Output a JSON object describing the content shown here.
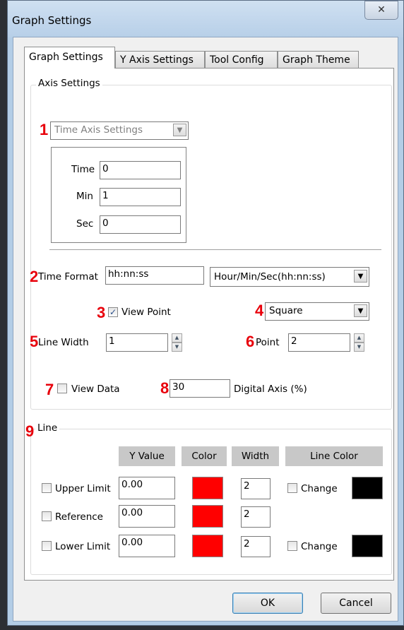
{
  "window": {
    "title": "Graph Settings",
    "close_glyph": "✕"
  },
  "tabs": [
    {
      "label": "Graph Settings"
    },
    {
      "label": "Y Axis Settings"
    },
    {
      "label": "Tool Config"
    },
    {
      "label": "Graph Theme"
    }
  ],
  "axis": {
    "legend": "Axis Settings",
    "time_axis_select": "Time Axis Settings",
    "fields": [
      {
        "label": "Time",
        "value": "0"
      },
      {
        "label": "Min",
        "value": "1"
      },
      {
        "label": "Sec",
        "value": "0"
      }
    ],
    "time_format_label": "Time Format",
    "time_format_value": "hh:nn:ss",
    "time_format_select": "Hour/Min/Sec(hh:nn:ss)",
    "view_point_label": "View Point",
    "view_point_checked": true,
    "point_shape": "Square",
    "line_width_label": "Line Width",
    "line_width_value": "1",
    "point_label": "Point",
    "point_value": "2",
    "view_data_label": "View Data",
    "view_data_checked": false,
    "digital_axis_value": "30",
    "digital_axis_label": "Digital Axis (%)"
  },
  "line": {
    "legend": "Line",
    "headers": {
      "y_value": "Y Value",
      "color": "Color",
      "width": "Width",
      "line_color": "Line Color"
    },
    "rows": [
      {
        "label": "Upper Limit",
        "y_value": "0.00",
        "color": "#ff0000",
        "width": "2",
        "change_label": "Change",
        "line_color": "#000000"
      },
      {
        "label": "Reference",
        "y_value": "0.00",
        "color": "#ff0000",
        "width": "2"
      },
      {
        "label": "Lower Limit",
        "y_value": "0.00",
        "color": "#ff0000",
        "width": "2",
        "change_label": "Change",
        "line_color": "#000000"
      }
    ]
  },
  "annotations": [
    "1",
    "2",
    "3",
    "4",
    "5",
    "6",
    "7",
    "8",
    "9"
  ],
  "buttons": {
    "ok": "OK",
    "cancel": "Cancel"
  },
  "colors": {
    "annotation": "#e8000b",
    "title_bar": "#b7cfe8"
  }
}
